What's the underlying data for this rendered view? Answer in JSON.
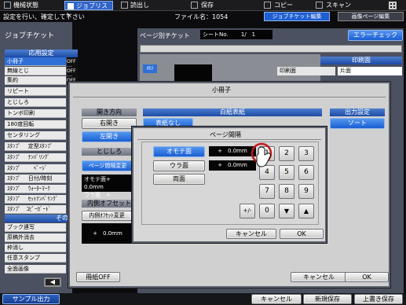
{
  "topnav": {
    "items": [
      {
        "label": "機械状態",
        "icon": "machine-status-icon"
      },
      {
        "label": "ジョブリスト",
        "icon": "job-list-icon"
      },
      {
        "label": "読出し",
        "icon": "read-icon"
      },
      {
        "label": "保存",
        "icon": "save-icon"
      },
      {
        "label": "コピー",
        "icon": "copy-icon"
      },
      {
        "label": "スキャン",
        "icon": "scan-icon"
      },
      {
        "label": "",
        "icon": "grid-icon"
      }
    ]
  },
  "header": {
    "message": "設定を行い、確定して下さい",
    "file_label": "ファイル名：1054"
  },
  "tabs": {
    "ticket_edit": "ジョブチケット編集",
    "page_edit": "画像ページ編集"
  },
  "left": {
    "title": "ジョブチケット",
    "section1": "応用設定",
    "section2": "その他",
    "items": [
      {
        "label": "小冊子",
        "value": "OFF"
      },
      {
        "label": "無線とじ",
        "value": "OFF"
      },
      {
        "label": "集約",
        "value": "OFF"
      },
      {
        "label": "リピート",
        "value": "OFF"
      },
      {
        "label": "とじしろ",
        "value": "OFF"
      },
      {
        "label": "トンボ印刷",
        "value": "OFF"
      },
      {
        "label": "180度回転",
        "value": "OFF"
      },
      {
        "label": "センタリング",
        "value": "OFF"
      },
      {
        "label": "ｽﾀﾝﾌﾟ　 定型ｽﾀﾝﾌﾟ",
        "value": "OFF"
      },
      {
        "label": "ｽﾀﾝﾌﾟ　 ﾅﾝﾊﾞﾘﾝｸﾞ",
        "value": "OFF"
      },
      {
        "label": "ｽﾀﾝﾌﾟ　　 ﾍﾟｰｼﾞ",
        "value": "OFF"
      },
      {
        "label": "ｽﾀﾝﾌﾟ　 日付/時刻",
        "value": "OFF"
      },
      {
        "label": "ｽﾀﾝﾌﾟ　 ｳｫｰﾀｰﾏｰｸ",
        "value": "OFF"
      },
      {
        "label": "ｽﾀﾝﾌﾟ　 ｾｯﾄﾅﾝﾊﾞﾘﾝｸﾞ",
        "value": "OFF"
      },
      {
        "label": "ｽﾀﾝﾌﾟ　ｺﾋﾟｰｶﾞｰﾄﾞ",
        "value": "OFF"
      }
    ],
    "others": [
      "ブック連写",
      "原稿外消去",
      "枠消し",
      "任意スタンプ",
      "全面画像"
    ]
  },
  "page_ticket": {
    "label": "ページ別チケット",
    "sheet": "シートNo.",
    "page": "1/　1",
    "error_check": "エラーチェック",
    "omote": "ｵﾓﾃ",
    "print_side_header": "印刷面",
    "print_side_label": "印刷面",
    "print_side_value": "片面"
  },
  "booklet": {
    "title": "小冊子",
    "open_dir_header": "開き方向",
    "right_open": "右開き",
    "left_open": "左開き",
    "cover_header": "白紙表紙",
    "cover_none": "表紙なし",
    "output_header": "出力設定",
    "sort": "ソート",
    "binding_header": "とじしろ",
    "page_gap_change": "ページ間隔変更",
    "gap_front": "オモテ面+　 0.0mm",
    "gap_back": "ウラ面　+　 0.0mm",
    "inner_header": "内側オフセット",
    "inner_change": "内側ｵﾌｾｯﾄ変更",
    "inner_value": "+　0.0mm",
    "booklet_off": "冊紙OFF",
    "cancel": "キャンセル",
    "ok": "OK"
  },
  "gap_dialog": {
    "title": "ページ間隔",
    "front": "オモテ面",
    "back": "ウラ面",
    "both": "両面",
    "front_value": "+　0.0mm",
    "back_value": "+　0.0mm",
    "keys": [
      "1",
      "2",
      "3",
      "4",
      "5",
      "6",
      "7",
      "8",
      "9",
      "+/-",
      "0",
      "▼",
      "▲"
    ],
    "cancel": "キャンセル",
    "ok": "OK"
  },
  "footer": {
    "sample": "サンプル出力",
    "cancel": "キャンセル",
    "new_save": "新規保存",
    "overwrite": "上書き保存"
  }
}
